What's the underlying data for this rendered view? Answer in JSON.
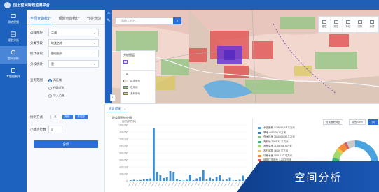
{
  "header": {
    "title": "国土空间规划监测平台"
  },
  "rail": {
    "items": [
      {
        "label": "用地规划"
      },
      {
        "label": "规划分析"
      },
      {
        "label": "空间分析"
      },
      {
        "label": "专题图制作"
      }
    ]
  },
  "panel": {
    "tabs": [
      "空间查询统计",
      "规划查询统计",
      "分类查询"
    ],
    "rows": [
      {
        "label": "选择图层",
        "value": "二调"
      },
      {
        "label": "分类字段",
        "value": "地类名称"
      },
      {
        "label": "统计字段",
        "value": "图斑面积"
      },
      {
        "label": "分段统计",
        "value": "是"
      }
    ],
    "scope_label": "查询范围",
    "scope_options": [
      "两区域",
      "行政区划",
      "导入范围"
    ],
    "draw_label": "绘制方式",
    "draw_buttons": [
      "点",
      "矩形",
      "多边形"
    ],
    "decimals_label": "小数点位数",
    "decimals_value": "2",
    "run_label": "分析"
  },
  "map": {
    "search_placeholder": "请输入地名...",
    "toolbar": [
      "图层",
      "测量",
      "标绘",
      "清除",
      "分屏"
    ],
    "legend_title": "分析图层",
    "legend_items": [
      "二调",
      "建设用地",
      "农用地",
      "未利用地"
    ]
  },
  "stats": {
    "tab_label": "统计结果",
    "chart_title": "地类面积统计图",
    "chart_unit": "面积(平方米)",
    "buttons": [
      "分类面积对比",
      "导出Excel",
      "打印"
    ],
    "legend": [
      {
        "name": "水田面积 1745414.18 平方米",
        "color": "#4aa3df"
      },
      {
        "name": "旱地 4453.70 平方米",
        "color": "#2b7fcf"
      },
      {
        "name": "乔木林地 1564509.09 平方米",
        "color": "#7bc67e"
      },
      {
        "name": "有林地 3069.32 平方米",
        "color": "#3fb27f"
      },
      {
        "name": "其他草地 11336.68 平方米",
        "color": "#a5d96a"
      },
      {
        "name": "农村道路 16.34 平方米",
        "color": "#f4c542"
      },
      {
        "name": "坑塘水面 19018.70 平方米",
        "color": "#f08c3a"
      },
      {
        "name": "城镇住宅用地 1.23 平方米",
        "color": "#d95f5f"
      },
      {
        "name": "其他 15000.60 平方米",
        "color": "#c9c9c9"
      }
    ]
  },
  "chart_data": {
    "type": "bar",
    "title": "",
    "ylabel": "",
    "ylim": [
      0,
      1600000
    ],
    "yticks": [
      "1,600,000",
      "1,400,000",
      "1,200,000",
      "1,000,000",
      "800,000",
      "600,000",
      "400,000",
      "200,000",
      "0"
    ],
    "values": [
      20000,
      30000,
      15000,
      25000,
      40000,
      60000,
      70000,
      1500000,
      250000,
      160000,
      80000,
      100000,
      280000,
      240000,
      60000,
      20000,
      10000,
      30000,
      180000,
      20000,
      70000,
      120000,
      310000,
      40000,
      90000,
      50000,
      120000,
      160000,
      30000,
      40000,
      90000,
      10000,
      20000,
      30000,
      150000,
      50000
    ]
  },
  "badge": {
    "text": "空间分析"
  },
  "colors": {
    "primary": "#1e62c0",
    "accent": "#2b6fd6",
    "bar": "#3a8fd9"
  }
}
